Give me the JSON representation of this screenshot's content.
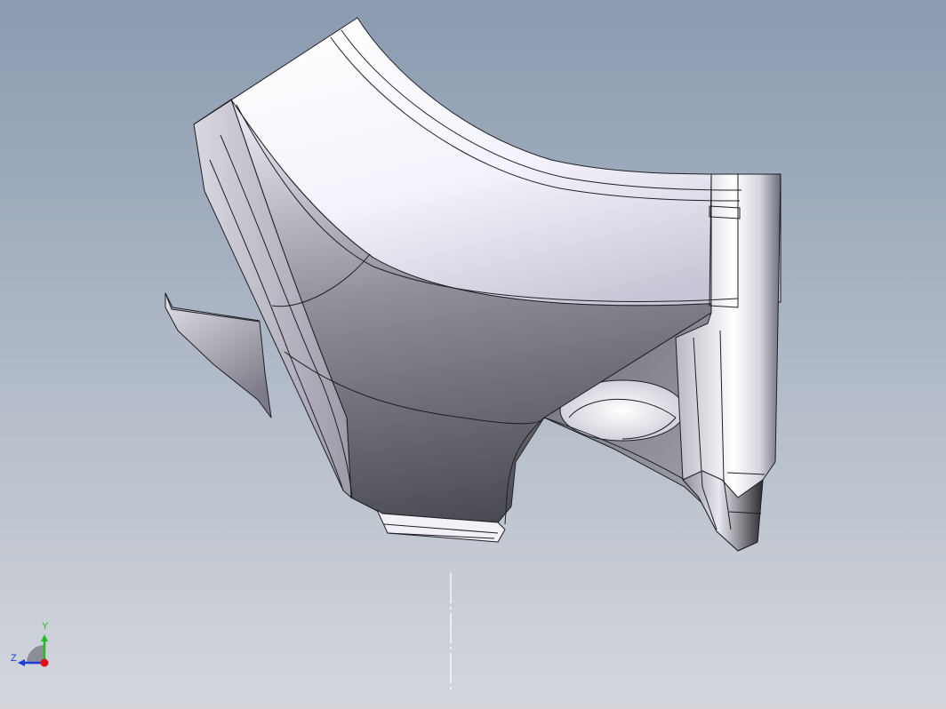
{
  "viewport": {
    "background_top": "#8a9bb0",
    "background_bottom": "#d4d6dc",
    "model": "sheet-metal-bracket-part",
    "center_line_color": "#ffffff"
  },
  "triad": {
    "y_label": "Y",
    "z_label": "Z",
    "y_color": "#20c020",
    "z_color": "#1a3cd8",
    "x_color": "#e01010"
  }
}
